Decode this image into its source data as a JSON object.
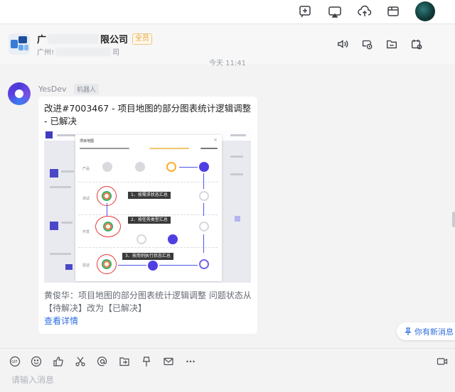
{
  "chat": {
    "title_visible_prefix": "广",
    "title_visible_suffix": "限公司",
    "badge": "全员",
    "subtitle_prefix": "广州!",
    "subtitle_suffix": "司",
    "time": "今天 11:41"
  },
  "message": {
    "sender": "YesDev",
    "sender_tag": "机器人",
    "title": "改进#7003467 - 项目地图的部分图表统计逻辑调整 - 已解决",
    "body": "黄俊华：项目地图的部分图表统计逻辑调整 问题状态从【待解决】改为【已解决】",
    "link": "查看详情",
    "image": {
      "modal_title": "项目地图",
      "row_labels": [
        "产品",
        "测试",
        "开发",
        "验证"
      ],
      "tips": [
        "1、按需求状态汇总",
        "2、按任务类型汇总",
        "3、按用例执行状态汇总"
      ]
    }
  },
  "new_messages_label": "你有新消息",
  "input": {
    "placeholder": "请输入消息"
  },
  "colors": {
    "accent": "#2f6de1",
    "badge": "#e4a23a",
    "bot": "#4a3bd6"
  }
}
